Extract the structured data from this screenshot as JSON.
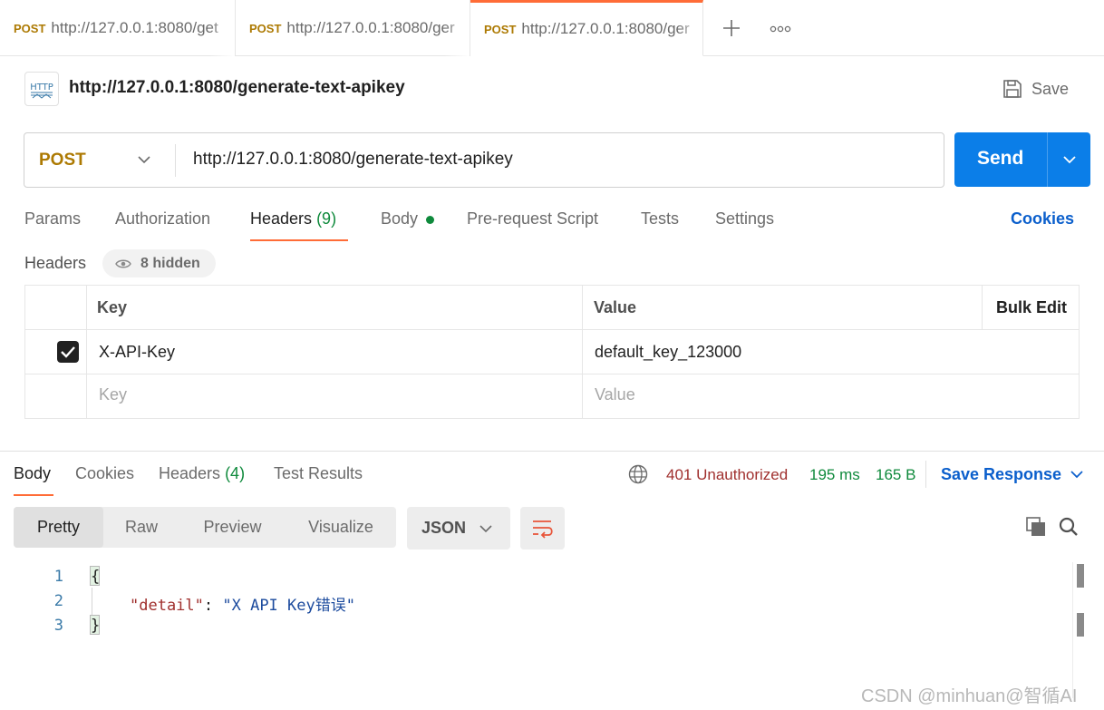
{
  "tabs": [
    {
      "method": "POST",
      "url": "http://127.0.0.1:8080/get"
    },
    {
      "method": "POST",
      "url": "http://127.0.0.1:8080/ger"
    },
    {
      "method": "POST",
      "url": "http://127.0.0.1:8080/ger"
    }
  ],
  "request": {
    "title": "http://127.0.0.1:8080/generate-text-apikey",
    "badge": "HTTP",
    "save_label": "Save",
    "method": "POST",
    "url": "http://127.0.0.1:8080/generate-text-apikey",
    "send_label": "Send"
  },
  "request_tabs": {
    "params": "Params",
    "authorization": "Authorization",
    "headers": "Headers",
    "headers_count": "(9)",
    "body": "Body",
    "prerequest": "Pre-request Script",
    "tests": "Tests",
    "settings": "Settings",
    "cookies": "Cookies"
  },
  "headers_section": {
    "title": "Headers",
    "hidden_label": "8 hidden",
    "columns": {
      "key": "Key",
      "value": "Value",
      "bulk_edit": "Bulk Edit"
    },
    "rows": [
      {
        "checked": true,
        "key": "X-API-Key",
        "value": "default_key_123000"
      }
    ],
    "placeholder": {
      "key": "Key",
      "value": "Value"
    }
  },
  "response_tabs": {
    "body": "Body",
    "cookies": "Cookies",
    "headers": "Headers",
    "headers_count": "(4)",
    "test_results": "Test Results"
  },
  "response_status": {
    "status": "401 Unauthorized",
    "time": "195 ms",
    "size": "165 B",
    "save_response": "Save Response"
  },
  "view_modes": {
    "pretty": "Pretty",
    "raw": "Raw",
    "preview": "Preview",
    "visualize": "Visualize",
    "format": "JSON"
  },
  "response_body": {
    "line_numbers": [
      "1",
      "2",
      "3"
    ],
    "open_brace": "{",
    "close_brace": "}",
    "key": "\"detail\"",
    "colon": ": ",
    "value": "\"X API Key错误\""
  },
  "watermark": "CSDN @minhuan@智循AI",
  "colors": {
    "accent_orange": "#ff6c37",
    "send_blue": "#0b7ee8",
    "method_gold": "#ad7a03",
    "status_error": "#a0302e",
    "status_ok": "#0f8a3c"
  }
}
